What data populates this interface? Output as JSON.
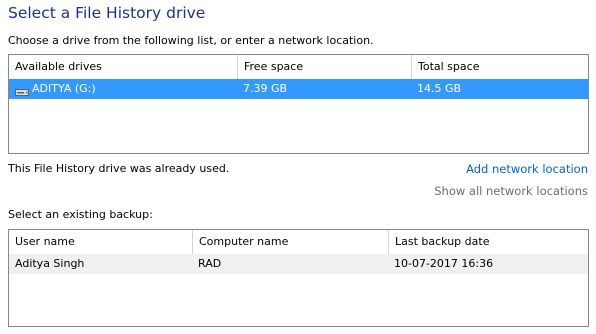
{
  "page": {
    "title": "Select a File History drive",
    "instruction": "Choose a drive from the following list, or enter a network location.",
    "status_text": "This File History drive was already used.",
    "add_network_location": "Add network location",
    "show_all_network_locations": "Show all network locations",
    "select_backup_label": "Select an existing backup:"
  },
  "drives": {
    "columns": [
      "Available drives",
      "Free space",
      "Total space"
    ],
    "rows": [
      {
        "name": "ADITYA (G:)",
        "free": "7.39 GB",
        "total": "14.5 GB",
        "icon": "drive-icon",
        "selected": true
      }
    ]
  },
  "backups": {
    "columns": [
      "User name",
      "Computer name",
      "Last backup date"
    ],
    "rows": [
      {
        "user": "Aditya Singh",
        "computer": "RAD",
        "date": "10-07-2017 16:36"
      }
    ]
  },
  "colors": {
    "title": "#1e3287",
    "selection": "#3399ff",
    "link": "#0066cc",
    "disabled_link": "#6d6d6d"
  }
}
